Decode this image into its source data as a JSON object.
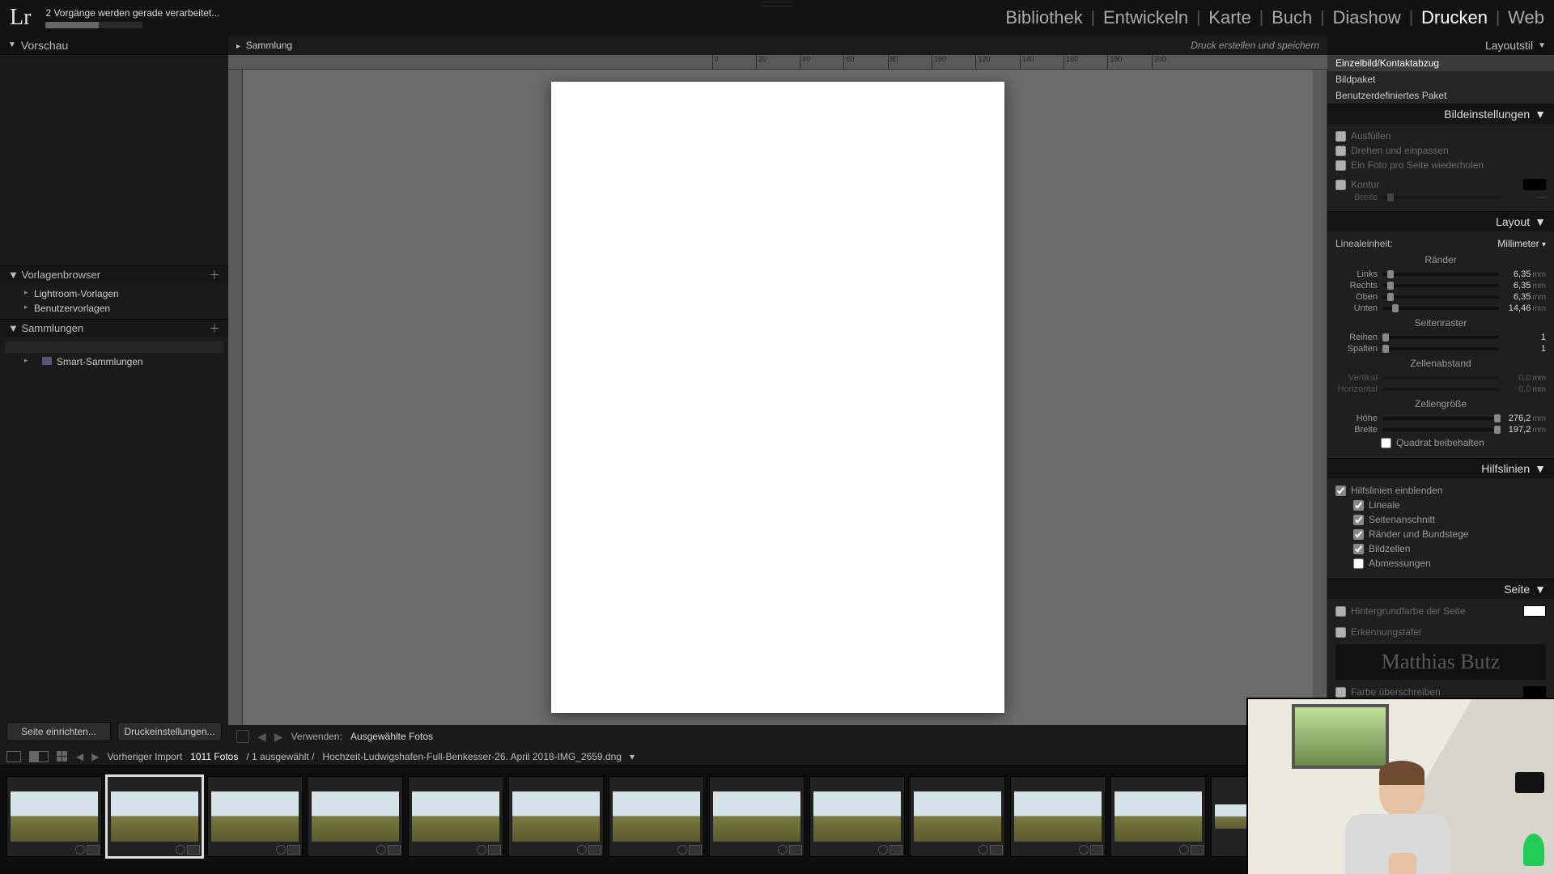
{
  "top": {
    "logo": "Lr",
    "task_text": "2 Vorgänge werden gerade verarbeitet..."
  },
  "modules": {
    "library": "Bibliothek",
    "develop": "Entwickeln",
    "map": "Karte",
    "book": "Buch",
    "slideshow": "Diashow",
    "print": "Drucken",
    "web": "Web"
  },
  "left": {
    "preview_title": "Vorschau",
    "templates_title": "Vorlagenbrowser",
    "templates": {
      "lightroom": "Lightroom-Vorlagen",
      "user": "Benutzervorlagen"
    },
    "collections_title": "Sammlungen",
    "smart": "Smart-Sammlungen",
    "btn_page_setup": "Seite einrichten...",
    "btn_print_settings": "Druckeinstellungen..."
  },
  "center": {
    "title": "Sammlung",
    "create_print": "Druck erstellen und speichern",
    "use_label": "Verwenden:",
    "use_value": "Ausgewählte Fotos"
  },
  "right": {
    "layout_style_title": "Layoutstil",
    "styles": {
      "single": "Einzelbild/Kontaktabzug",
      "package": "Bildpaket",
      "custom": "Benutzerdefiniertes Paket"
    },
    "image_settings_title": "Bildeinstellungen",
    "zoom_fill": "Ausfüllen",
    "rotate_fit": "Drehen und einpassen",
    "repeat": "Ein Foto pro Seite wiederholen",
    "stroke": "Kontur",
    "width_lbl": "Breite",
    "layout_title": "Layout",
    "ruler_units_lbl": "Linealeinheit:",
    "ruler_units_val": "Millimeter",
    "margins_head": "Ränder",
    "m_left_lbl": "Links",
    "m_left_val": "6,35",
    "m_right_lbl": "Rechts",
    "m_right_val": "6,35",
    "m_top_lbl": "Oben",
    "m_top_val": "6,35",
    "m_bottom_lbl": "Unten",
    "m_bottom_val": "14,46",
    "grid_head": "Seitenraster",
    "rows_lbl": "Reihen",
    "rows_val": "1",
    "cols_lbl": "Spalten",
    "cols_val": "1",
    "spacing_head": "Zellenabstand",
    "sp_v_lbl": "Vertikal",
    "sp_v_val": "0,0",
    "sp_h_lbl": "Horizontal",
    "sp_h_val": "0,0",
    "cellsize_head": "Zellengröße",
    "cs_h_lbl": "Höhe",
    "cs_h_val": "276,2",
    "cs_w_lbl": "Breite",
    "cs_w_val": "197,2",
    "keep_square": "Quadrat beibehalten",
    "guides_title": "Hilfslinien",
    "show_guides": "Hilfslinien einblenden",
    "g_rulers": "Lineale",
    "g_bleed": "Seitenanschnitt",
    "g_margins": "Ränder und Bundstege",
    "g_cells": "Bildzellen",
    "g_dims": "Abmessungen",
    "page_title": "Seite",
    "bg_color": "Hintergrundfarbe der Seite",
    "identity": "Erkennungstafel",
    "identity_text": "Matthias Butz",
    "override_color": "Farbe überschreiben",
    "unit_mm": "mm"
  },
  "filmstrip": {
    "prev_import": "Vorheriger Import",
    "count": "1011 Fotos",
    "selected": "/ 1 ausgewählt /",
    "path": "Hochzeit-Ludwigshafen-Full-Benkesser-26. April 2018-IMG_2659.dng",
    "caret": "▾"
  }
}
